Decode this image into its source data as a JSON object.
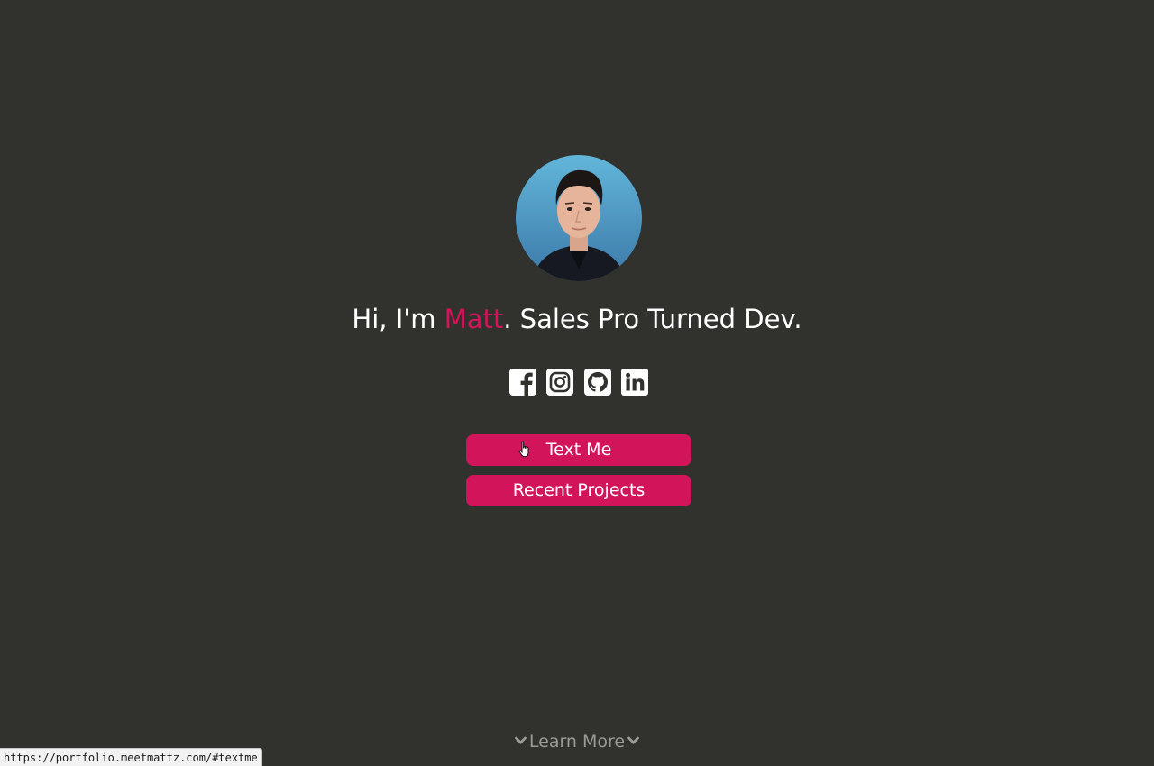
{
  "hero": {
    "greeting": "Hi, I'm ",
    "name": "Matt",
    "tagline": ". Sales Pro Turned Dev.",
    "accent_color": "#d2155b",
    "avatar": {
      "label": "Profile photo",
      "background_top": "#5fb4d8",
      "background_bottom": "#3f7fb0"
    }
  },
  "socials": [
    {
      "name": "Facebook",
      "icon": "facebook-icon"
    },
    {
      "name": "Instagram",
      "icon": "instagram-icon"
    },
    {
      "name": "GitHub",
      "icon": "github-icon"
    },
    {
      "name": "LinkedIn",
      "icon": "linkedin-icon"
    }
  ],
  "buttons": {
    "text_me": "Text Me",
    "recent_projects": "Recent Projects"
  },
  "footer": {
    "learn_more": "Learn More"
  },
  "status_bar": {
    "url": "https://portfolio.meetmattz.com/#textme"
  },
  "colors": {
    "background": "#31312e",
    "button": "#d2155b",
    "text": "#ffffff",
    "muted": "#9a9a96"
  }
}
